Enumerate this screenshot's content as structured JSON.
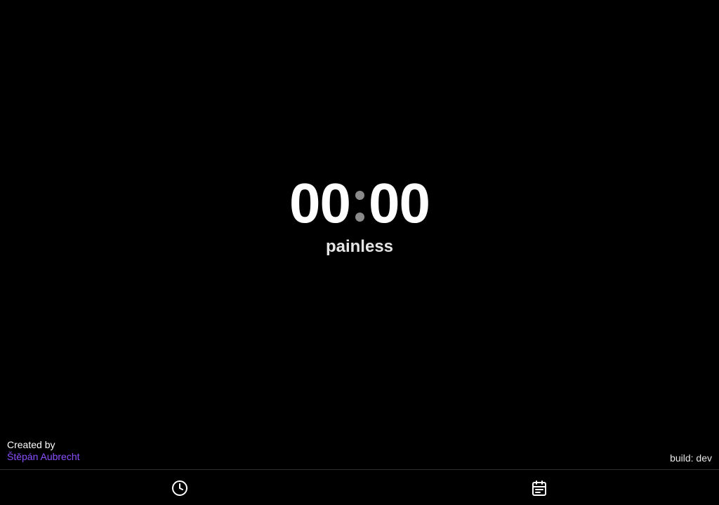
{
  "timer": {
    "minutes": "00",
    "seconds": "00",
    "label": "painless"
  },
  "credits": {
    "prefix": "Created by",
    "author": "Štěpán Aubrecht"
  },
  "build": {
    "text": "build: dev"
  },
  "nav": {
    "items": [
      {
        "icon": "clock-icon"
      },
      {
        "icon": "calendar-icon"
      }
    ]
  },
  "colors": {
    "background": "#000000",
    "text": "#ffffff",
    "colon": "#8a8a8a",
    "link": "#8a4fff",
    "divider": "#2e2e2e"
  }
}
